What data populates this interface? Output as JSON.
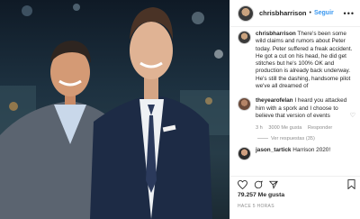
{
  "post": {
    "author": "chrisbharrison",
    "follow_label": "Seguir",
    "separator": "•",
    "more_label": "•••"
  },
  "comments": [
    {
      "user": "chrisbharrison",
      "text": "There's been some wild claims and rumors about Peter today. Peter suffered a freak accident. He got a cut on his head, he did get stitches but he's 100% OK and production is already back underway. He's still the dashing, handsome pilot we've all dreamed of"
    },
    {
      "user": "theyearofelan",
      "text": "I heard you attacked him with a spork and I choose to believe that version of events",
      "age": "3 h",
      "likes": "3000 Me gusta",
      "reply": "Responder",
      "view_replies": "Ver respuestas (35)"
    },
    {
      "user": "jason_tartick",
      "text": "Harrison 2020!"
    }
  ],
  "likes_count": "79.257 Me gusta",
  "timestamp": "HACE 5 HORAS",
  "colors": {
    "accent": "#3897f0",
    "text": "#262626",
    "muted": "#8e8e8e"
  },
  "icons": [
    "heart-icon",
    "comment-icon",
    "share-icon",
    "save-icon"
  ]
}
